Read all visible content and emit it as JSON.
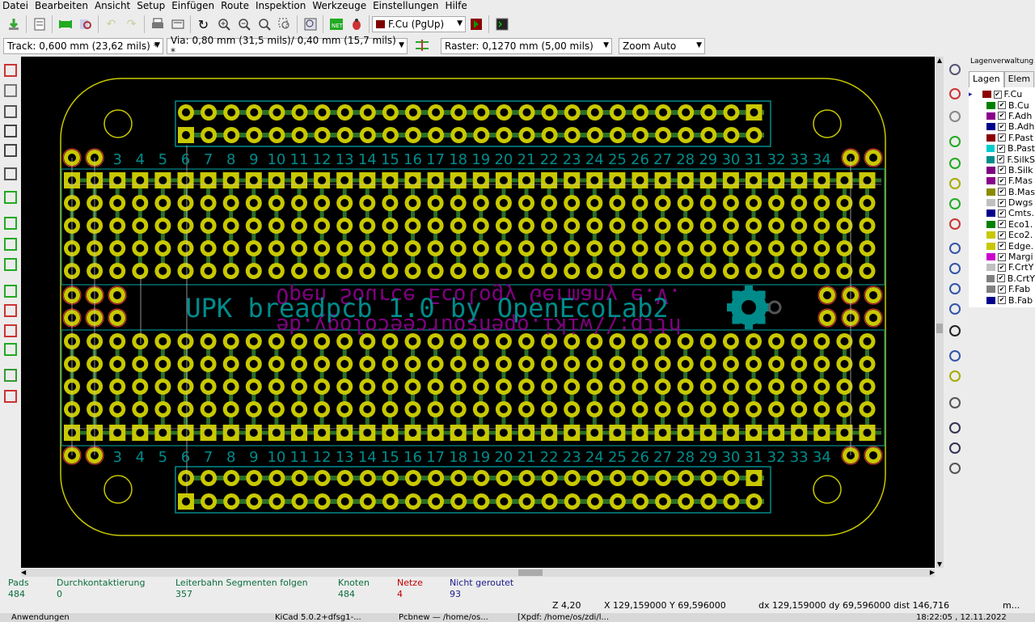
{
  "menu": [
    "Datei",
    "Bearbeiten",
    "Ansicht",
    "Setup",
    "Einfügen",
    "Route",
    "Inspektion",
    "Werkzeuge",
    "Einstellungen",
    "Hilfe"
  ],
  "toolbar": {
    "layer_select": "F.Cu (PgUp)",
    "layer_color": "#800000"
  },
  "track": "Track: 0,600 mm (23,62 mils) *",
  "via": "Via: 0,80 mm (31,5 mils)/ 0,40 mm (15,7 mils) *",
  "raster": "Raster: 0,1270 mm (5,00 mils)",
  "zoom": "Zoom Auto",
  "left_icons": [
    "drc-icon",
    "grid-icon",
    "polar-icon",
    "inch-icon",
    "mm-icon",
    "cursor-icon",
    "pads-sketch-icon",
    "via-sketch-icon",
    "track-sketch-icon",
    "zone-sketch-icon",
    "ratsnest-icon",
    "local-ratsnest-icon",
    "microwave-icon",
    "auto-place-icon",
    "layers-icon",
    "wave-icon"
  ],
  "right_icons": [
    "select-arrow-icon",
    "highlight-net-icon",
    "local-ratsnest-tool-icon",
    "add-footprint-icon",
    "route-track-icon",
    "add-via-icon",
    "add-zone-icon",
    "keepout-icon",
    "add-line-icon",
    "add-circle-icon",
    "add-arc-icon",
    "add-polygon-icon",
    "add-text-icon",
    "dimension-icon",
    "target-icon",
    "delete-icon",
    "anchor-icon",
    "grid-origin-icon",
    "measure-icon"
  ],
  "layer_panel": {
    "title": "Lagenverwaltung",
    "tab_layers": "Lagen",
    "tab_elements": "Elem",
    "layers": [
      {
        "name": "F.Cu",
        "color": "#8b0000"
      },
      {
        "name": "B.Cu",
        "color": "#008000"
      },
      {
        "name": "F.Adh",
        "color": "#8b008b"
      },
      {
        "name": "B.Adh",
        "color": "#00008b"
      },
      {
        "name": "F.Past",
        "color": "#8b0000"
      },
      {
        "name": "B.Past",
        "color": "#00cccc"
      },
      {
        "name": "F.SilkS",
        "color": "#008b8b"
      },
      {
        "name": "B.Silk",
        "color": "#800080"
      },
      {
        "name": "F.Mas",
        "color": "#8b008b"
      },
      {
        "name": "B.Mas",
        "color": "#8b8b00"
      },
      {
        "name": "Dwgs",
        "color": "#c0c0c0"
      },
      {
        "name": "Cmts.",
        "color": "#00008b"
      },
      {
        "name": "Eco1.",
        "color": "#008000"
      },
      {
        "name": "Eco2.",
        "color": "#c8c800"
      },
      {
        "name": "Edge.",
        "color": "#c8c800"
      },
      {
        "name": "Margi",
        "color": "#cc00cc"
      },
      {
        "name": "F.CrtY",
        "color": "#c0c0c0"
      },
      {
        "name": "B.CrtY",
        "color": "#808080"
      },
      {
        "name": "F.Fab",
        "color": "#808080"
      },
      {
        "name": "B.Fab",
        "color": "#00008b"
      }
    ]
  },
  "pcb": {
    "title": "UPK breadpcb 1.0  by OpenEcoLab2",
    "mirror1": "Open Source Ecology Germany e.V.",
    "mirror2": "http://wiki.opensourceecology.de",
    "logo": "OSHW",
    "numbers": [
      "3",
      "4",
      "5",
      "6",
      "7",
      "8",
      "9",
      "10",
      "11",
      "12",
      "13",
      "14",
      "15",
      "16",
      "17",
      "18",
      "19",
      "20",
      "21",
      "22",
      "23",
      "24",
      "25",
      "26",
      "27",
      "28",
      "29",
      "30",
      "31",
      "32",
      "33",
      "34"
    ]
  },
  "status": {
    "pads_label": "Pads",
    "pads_value": "484",
    "vias_label": "Durchkontaktierung",
    "vias_value": "0",
    "tracks_label": "Leiterbahn Segmenten folgen",
    "tracks_value": "357",
    "nodes_label": "Knoten",
    "nodes_value": "484",
    "nets_label": "Netze",
    "nets_value": "4",
    "unrouted_label": "Nicht geroutet",
    "unrouted_value": "93"
  },
  "coords": {
    "z": "Z 4,20",
    "xy": "X 129,159000  Y 69,596000",
    "dxy": "dx 129,159000  dy 69,596000  dist 146,716",
    "unit": "m..."
  },
  "taskbar": {
    "apps": "Anwendungen",
    "kicad": "KiCad 5.0.2+dfsg1-...",
    "pcbnew": "Pcbnew — /home/os...",
    "xpdf": "[Xpdf: /home/os/zdi/l...",
    "clock": "18:22:05 , 12.11.2022"
  }
}
